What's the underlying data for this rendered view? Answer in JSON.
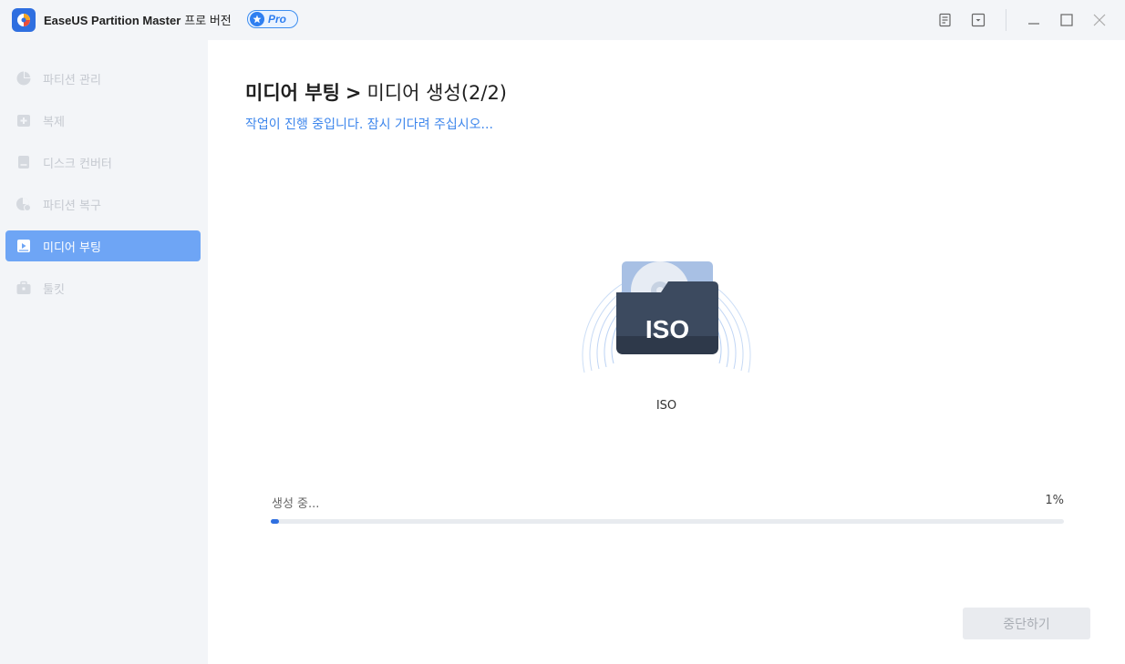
{
  "app": {
    "title_en": "EaseUS Partition Master",
    "title_ko": "프로 버전",
    "badge": "Pro",
    "icons": [
      "feedback-icon",
      "dropdown-menu-icon",
      "minimize-icon",
      "maximize-icon",
      "close-icon"
    ]
  },
  "sidebar": {
    "items": [
      {
        "label": "파티션 관리",
        "icon": "pie-chart-icon",
        "active": false
      },
      {
        "label": "복제",
        "icon": "clone-icon",
        "active": false
      },
      {
        "label": "디스크 컨버터",
        "icon": "disk-converter-icon",
        "active": false
      },
      {
        "label": "파티션 복구",
        "icon": "partition-recovery-icon",
        "active": false
      },
      {
        "label": "미디어 부팅",
        "icon": "media-boot-icon",
        "active": true
      },
      {
        "label": "툴킷",
        "icon": "toolkit-icon",
        "active": false
      }
    ]
  },
  "main": {
    "heading_part1": "미디어 부팅",
    "heading_sep": ">",
    "heading_part2": "미디어 생성",
    "heading_step": "(2/2)",
    "subtitle": "작업이 진행 중입니다. 잠시 기다려 주십시오...",
    "media_label": "ISO",
    "media_icon_text": "ISO",
    "progress": {
      "label": "생성 중...",
      "percent_text": "1%",
      "value": 0.01
    },
    "stop_button": "중단하기"
  },
  "colors": {
    "accent": "#2f6fe0",
    "sidebar_active": "#6ea5f5",
    "subtitle": "#3d86ec"
  }
}
